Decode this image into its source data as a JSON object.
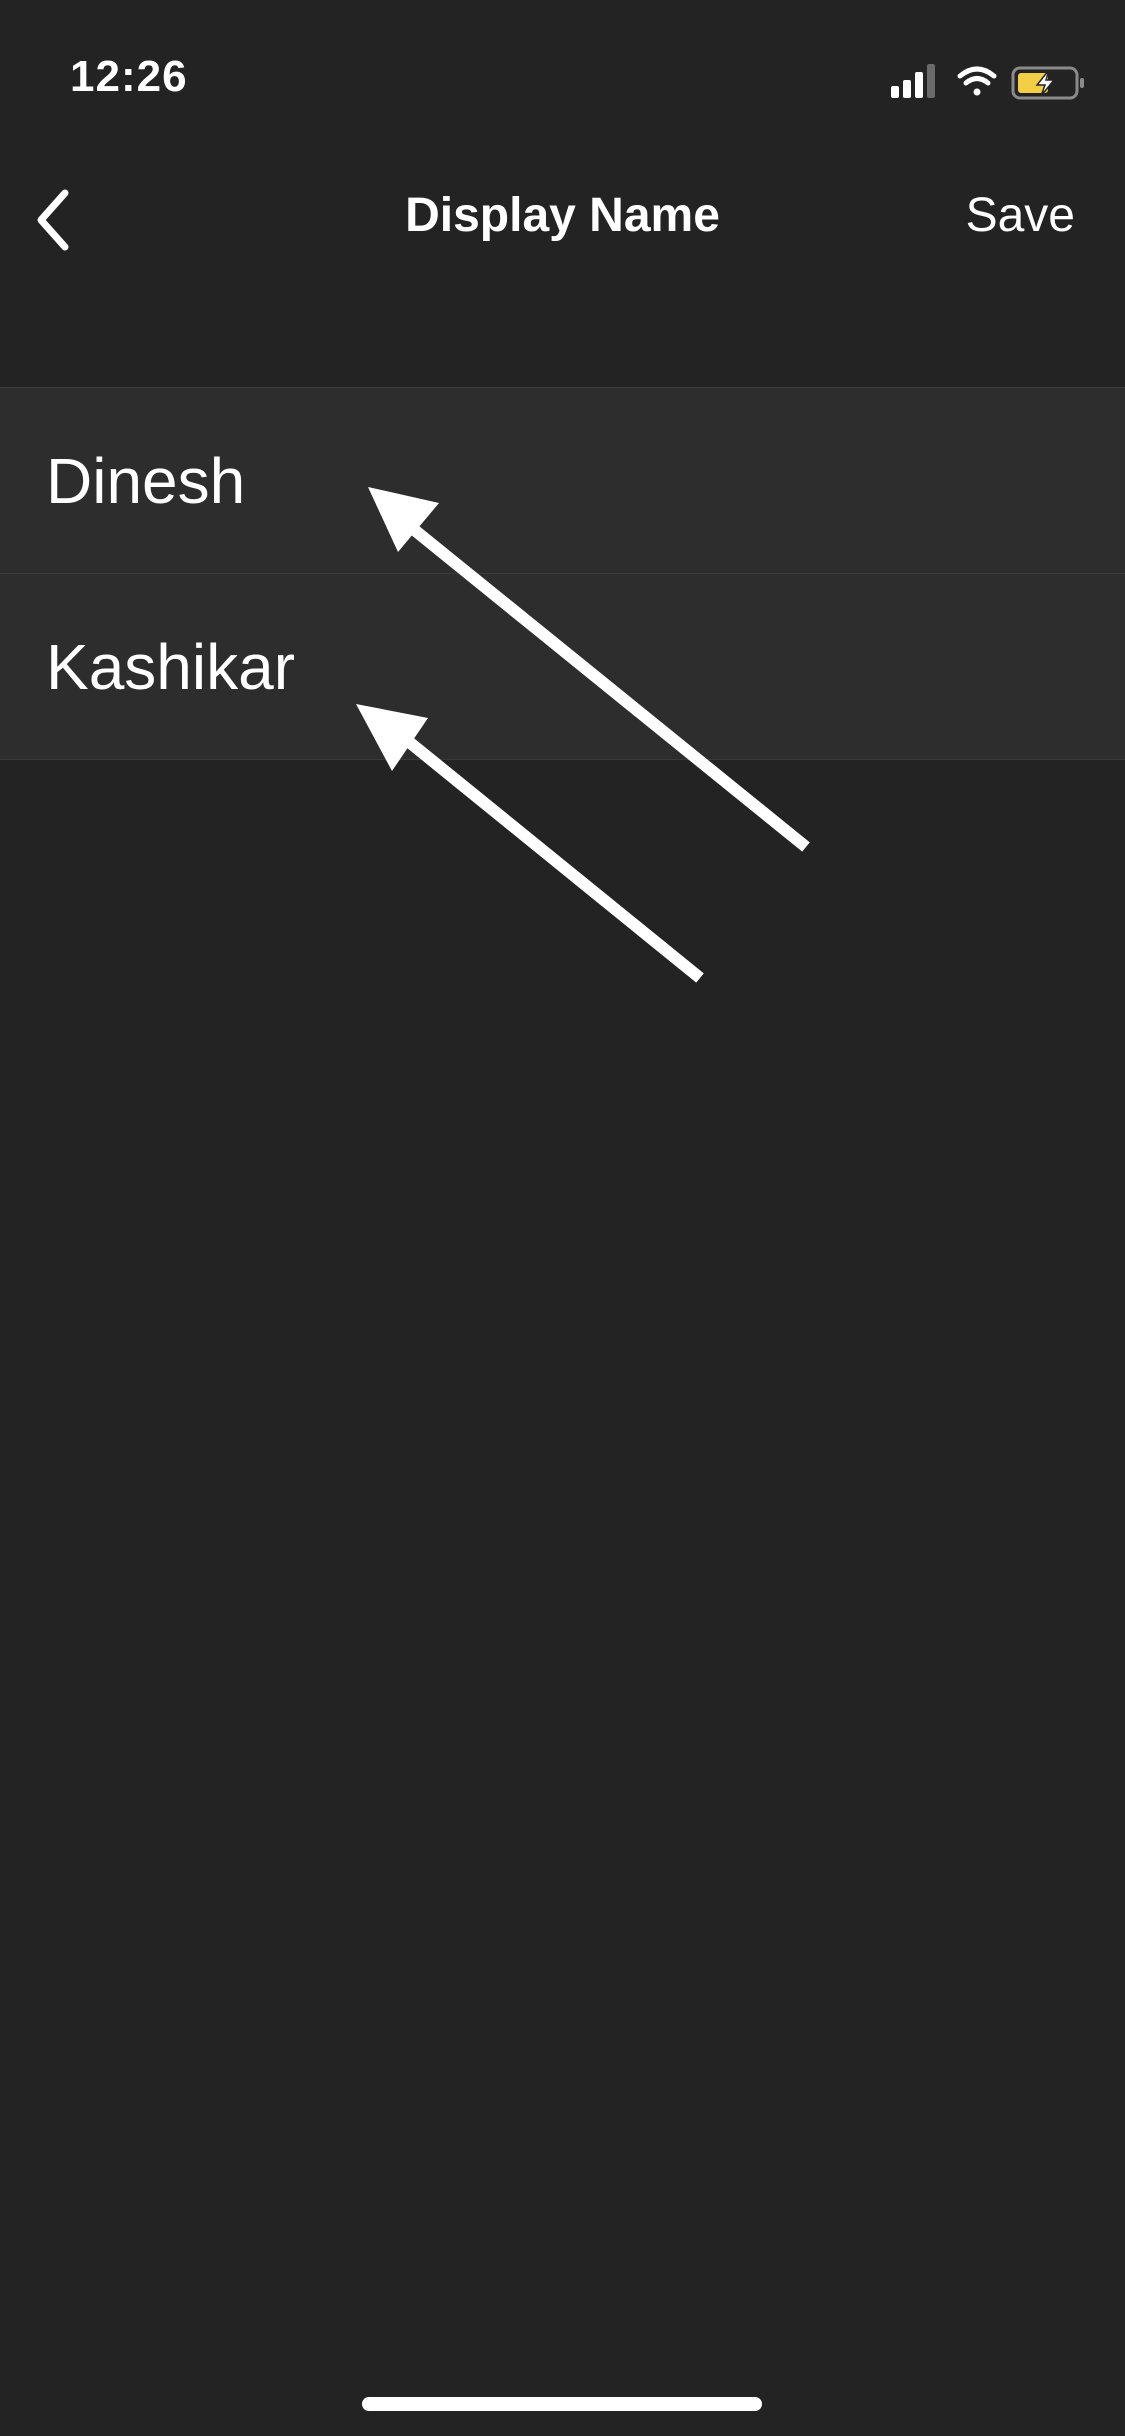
{
  "status_bar": {
    "time": "12:26",
    "battery_color": "#f4cf45",
    "icons": [
      "cellular-signal-icon",
      "wifi-icon",
      "battery-charging-icon"
    ]
  },
  "nav": {
    "back_icon": "chevron-left-icon",
    "title": "Display Name",
    "save_label": "Save"
  },
  "fields": {
    "first_name": "Dinesh",
    "last_name": "Kashikar"
  },
  "colors": {
    "background": "#232323",
    "row_background": "#2d2d2d",
    "separator": "#3a3a3a",
    "text": "#ffffff"
  },
  "annotations": [
    "arrow-icon",
    "arrow-icon"
  ]
}
